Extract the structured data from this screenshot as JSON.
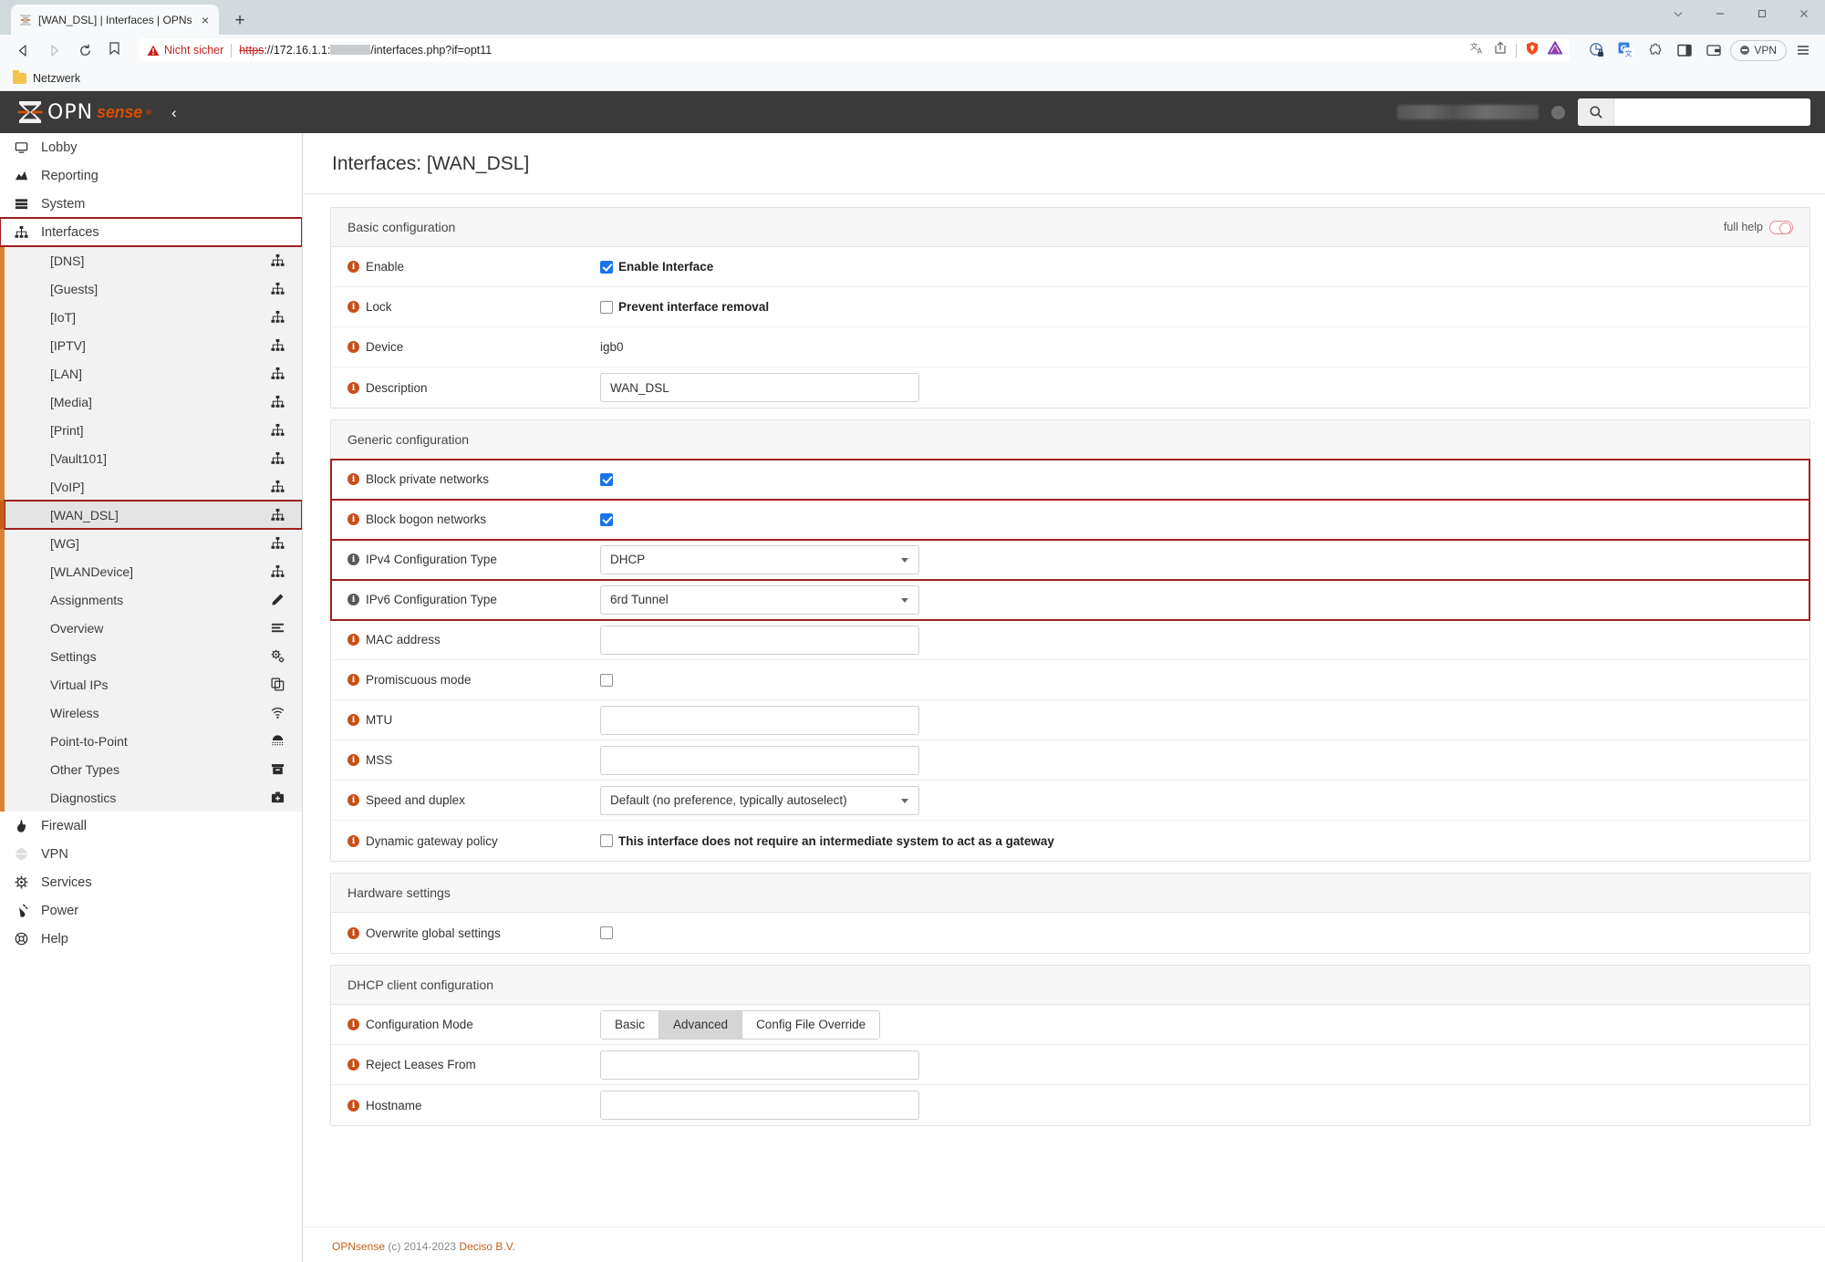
{
  "browser": {
    "tab": {
      "title": "[WAN_DSL] | Interfaces | OPNsens",
      "close": "×",
      "favicon_name": "opnsense-favicon"
    },
    "new_tab": "+",
    "window_controls": {
      "chevron": "⌄",
      "minimize": "─",
      "maximize": "□",
      "close": "✕"
    },
    "nav": {
      "back": "◁",
      "forward": "▷",
      "reload": "↻"
    },
    "omnibox": {
      "security_label": "Nicht sicher",
      "url_scheme": "https",
      "url_rest": "://172.16.1.1:",
      "url_path": "/interfaces.php?if=opt11"
    },
    "vpn_label": "VPN",
    "bookmark": {
      "label": "Netzwerk"
    }
  },
  "app_header": {
    "logo_opn": "OPN",
    "logo_sense": "sense",
    "logo_reg": "®",
    "collapse": "‹",
    "search_placeholder": ""
  },
  "sidebar": {
    "top_items": [
      {
        "label": "Lobby",
        "icon": "monitor-icon"
      },
      {
        "label": "Reporting",
        "icon": "chart-area-icon"
      },
      {
        "label": "System",
        "icon": "server-icon"
      },
      {
        "label": "Interfaces",
        "icon": "sitemap-icon",
        "annotated": true,
        "expanded": true
      }
    ],
    "interface_items": [
      {
        "label": "[DNS]",
        "icon": "sitemap-icon"
      },
      {
        "label": "[Guests]",
        "icon": "sitemap-icon"
      },
      {
        "label": "[IoT]",
        "icon": "sitemap-icon"
      },
      {
        "label": "[IPTV]",
        "icon": "sitemap-icon"
      },
      {
        "label": "[LAN]",
        "icon": "sitemap-icon"
      },
      {
        "label": "[Media]",
        "icon": "sitemap-icon"
      },
      {
        "label": "[Print]",
        "icon": "sitemap-icon"
      },
      {
        "label": "[Vault101]",
        "icon": "sitemap-icon"
      },
      {
        "label": "[VoIP]",
        "icon": "sitemap-icon"
      },
      {
        "label": "[WAN_DSL]",
        "icon": "sitemap-icon",
        "selected": true,
        "annotated": true
      },
      {
        "label": "[WG]",
        "icon": "sitemap-icon"
      },
      {
        "label": "[WLANDevice]",
        "icon": "sitemap-icon"
      },
      {
        "label": "Assignments",
        "icon": "pencil-icon"
      },
      {
        "label": "Overview",
        "icon": "list-icon"
      },
      {
        "label": "Settings",
        "icon": "gears-icon"
      },
      {
        "label": "Virtual IPs",
        "icon": "copy-icon"
      },
      {
        "label": "Wireless",
        "icon": "wifi-icon"
      },
      {
        "label": "Point-to-Point",
        "icon": "modem-icon"
      },
      {
        "label": "Other Types",
        "icon": "archive-icon"
      },
      {
        "label": "Diagnostics",
        "icon": "medkit-icon"
      }
    ],
    "bottom_items": [
      {
        "label": "Firewall",
        "icon": "fire-icon"
      },
      {
        "label": "VPN",
        "icon": "globe-icon"
      },
      {
        "label": "Services",
        "icon": "gear-icon"
      },
      {
        "label": "Power",
        "icon": "plug-icon"
      },
      {
        "label": "Help",
        "icon": "lifebuoy-icon"
      }
    ]
  },
  "page": {
    "title": "Interfaces: [WAN_DSL]",
    "full_help_label": "full help"
  },
  "panels": [
    {
      "title": "Basic configuration",
      "rows": [
        {
          "label": "Enable",
          "type": "checkbox",
          "checkbox_label": "Enable Interface",
          "checked": true,
          "info": "orange"
        },
        {
          "label": "Lock",
          "type": "checkbox",
          "checkbox_label": "Prevent interface removal",
          "checked": false,
          "info": "orange"
        },
        {
          "label": "Device",
          "type": "text_value",
          "value": "igb0",
          "info": "orange"
        },
        {
          "label": "Description",
          "type": "input",
          "value": "WAN_DSL",
          "info": "orange"
        }
      ]
    },
    {
      "title": "Generic configuration",
      "rows": [
        {
          "label": "Block private networks",
          "type": "bare_checkbox",
          "checked": true,
          "info": "orange",
          "annotated": true
        },
        {
          "label": "Block bogon networks",
          "type": "bare_checkbox",
          "checked": true,
          "info": "orange",
          "annotated": true
        },
        {
          "label": "IPv4 Configuration Type",
          "type": "select",
          "value": "DHCP",
          "info": "gray",
          "annotated": true
        },
        {
          "label": "IPv6 Configuration Type",
          "type": "select",
          "value": "6rd Tunnel",
          "info": "gray",
          "annotated": true
        },
        {
          "label": "MAC address",
          "type": "input",
          "value": "",
          "info": "orange"
        },
        {
          "label": "Promiscuous mode",
          "type": "bare_checkbox",
          "checked": false,
          "info": "orange"
        },
        {
          "label": "MTU",
          "type": "input",
          "value": "",
          "info": "orange"
        },
        {
          "label": "MSS",
          "type": "input",
          "value": "",
          "info": "orange"
        },
        {
          "label": "Speed and duplex",
          "type": "select",
          "value": "Default (no preference, typically autoselect)",
          "info": "orange"
        },
        {
          "label": "Dynamic gateway policy",
          "type": "checkbox",
          "checkbox_label": "This interface does not require an intermediate system to act as a gateway",
          "checked": false,
          "info": "orange"
        }
      ]
    },
    {
      "title": "Hardware settings",
      "rows": [
        {
          "label": "Overwrite global settings",
          "type": "bare_checkbox",
          "checked": false,
          "info": "orange"
        }
      ]
    },
    {
      "title": "DHCP client configuration",
      "rows": [
        {
          "label": "Configuration Mode",
          "type": "button_group",
          "options": [
            "Basic",
            "Advanced",
            "Config File Override"
          ],
          "selected": "Advanced",
          "info": "orange"
        },
        {
          "label": "Reject Leases From",
          "type": "input",
          "value": "",
          "info": "orange"
        },
        {
          "label": "Hostname",
          "type": "input",
          "value": "",
          "info": "orange"
        }
      ]
    }
  ],
  "footer": {
    "brand": "OPNsense",
    "text": " (c) 2014-2023 ",
    "company": "Deciso B.V."
  }
}
